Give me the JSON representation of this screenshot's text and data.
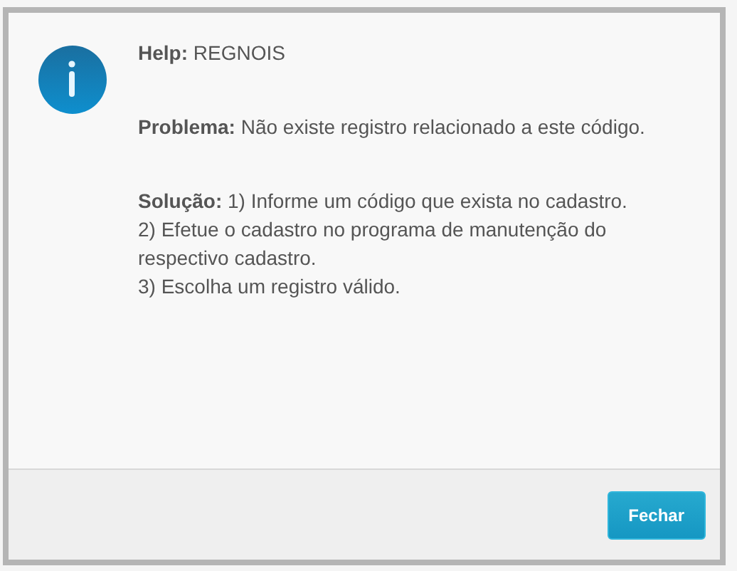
{
  "dialog": {
    "sections": [
      {
        "lines": [
          "**Help:** REGNOIS"
        ]
      },
      {
        "lines": [
          "**Problema:** Não existe registro relacionado a este código."
        ]
      },
      {
        "lines": [
          "**Solução:** 1) Informe um código que exista no cadastro.",
          "2) Efetue o cadastro no programa de manutenção do respectivo cadastro.",
          "3) Escolha um registro válido."
        ]
      }
    ],
    "buttons": [
      "Fechar"
    ]
  }
}
